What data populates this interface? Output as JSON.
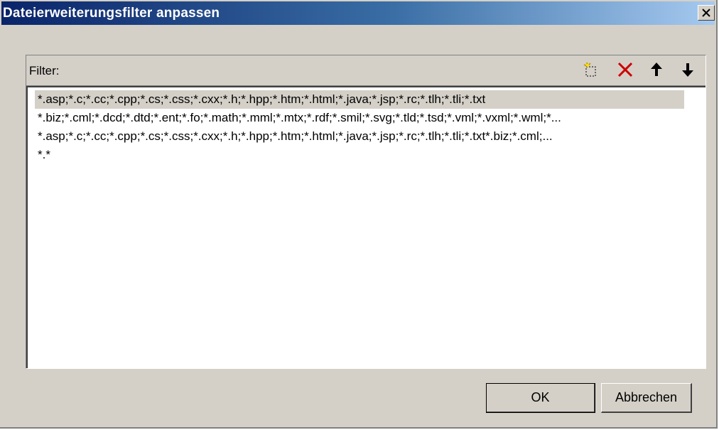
{
  "window": {
    "title": "Dateierweiterungsfilter anpassen"
  },
  "filter": {
    "label": "Filter:",
    "toolbar": {
      "new_icon": "new-item-icon",
      "delete_icon": "delete-x-icon",
      "up_icon": "arrow-up-icon",
      "down_icon": "arrow-down-icon"
    },
    "items": [
      "*.asp;*.c;*.cc;*.cpp;*.cs;*.css;*.cxx;*.h;*.hpp;*.htm;*.html;*.java;*.jsp;*.rc;*.tlh;*.tli;*.txt",
      "*.biz;*.cml;*.dcd;*.dtd;*.ent;*.fo;*.math;*.mml;*.mtx;*.rdf;*.smil;*.svg;*.tld;*.tsd;*.vml;*.vxml;*.wml;*...",
      "*.asp;*.c;*.cc;*.cpp;*.cs;*.css;*.cxx;*.h;*.hpp;*.htm;*.html;*.java;*.jsp;*.rc;*.tlh;*.tli;*.txt*.biz;*.cml;...",
      "*.*"
    ],
    "selected_index": 0
  },
  "buttons": {
    "ok": "OK",
    "cancel": "Abbrechen"
  },
  "colors": {
    "titlebar_start": "#0a246a",
    "titlebar_end": "#a6caf0",
    "face": "#d4d0c8",
    "delete_red": "#cc0000"
  }
}
